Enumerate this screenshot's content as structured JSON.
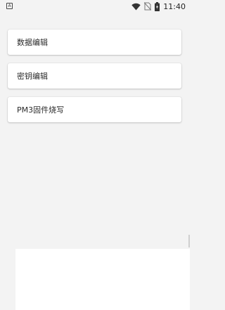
{
  "status_bar": {
    "time": "11:40",
    "left_icon_letter": "A"
  },
  "menu": {
    "items": [
      {
        "label": "数据编辑"
      },
      {
        "label": "密钥编辑"
      },
      {
        "label": "PM3固件烧写"
      }
    ]
  }
}
